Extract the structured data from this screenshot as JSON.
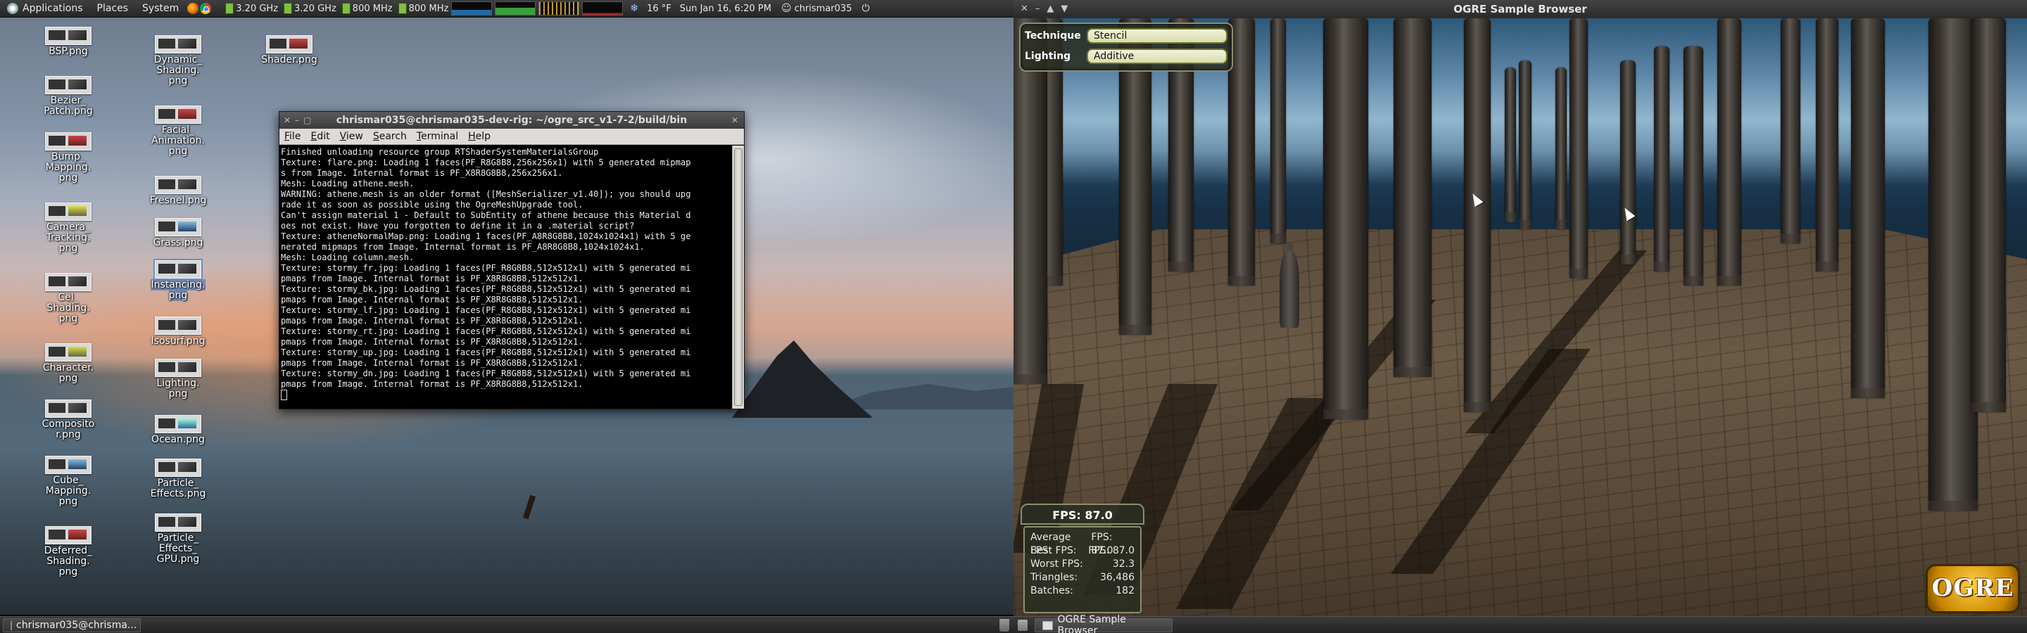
{
  "top_panel": {
    "menus": [
      "Applications",
      "Places",
      "System"
    ],
    "cpu_freqs": [
      "3.20 GHz",
      "3.20 GHz",
      "800 MHz",
      "800 MHz"
    ],
    "weather": "16 °F",
    "datetime": "Sun Jan 16,  6:20 PM",
    "user": "chrismar035"
  },
  "desktop_icons": [
    {
      "label": "BSP.png"
    },
    {
      "label": "Bezier_\nPatch.png"
    },
    {
      "label": "Bump_\nMapping.\npng"
    },
    {
      "label": "Camera_\nTracking.\npng"
    },
    {
      "label": "Cel_\nShading.\npng"
    },
    {
      "label": "Character.\npng"
    },
    {
      "label": "Composito\nr.png"
    },
    {
      "label": "Cube_\nMapping.\npng"
    },
    {
      "label": "Deferred_\nShading.\npng"
    },
    {
      "label": "Dynamic_\nShading.\npng"
    },
    {
      "label": "Facial_\nAnimation.\npng"
    },
    {
      "label": "Fresnel.png"
    },
    {
      "label": "Grass.png"
    },
    {
      "label": "Instancing.\npng"
    },
    {
      "label": "Isosurf.png"
    },
    {
      "label": "Lighting.\npng"
    },
    {
      "label": "Ocean.png"
    },
    {
      "label": "Particle_\nEffects.png"
    },
    {
      "label": "Particle_\nEffects_\nGPU.png"
    },
    {
      "label": "Shader.png"
    }
  ],
  "terminal": {
    "title": "chrismar035@chrismar035-dev-rig: ~/ogre_src_v1-7-2/build/bin",
    "menu": [
      "File",
      "Edit",
      "View",
      "Search",
      "Terminal",
      "Help"
    ],
    "lines": [
      "Finished unloading resource group RTShaderSystemMaterialsGroup",
      "Texture: flare.png: Loading 1 faces(PF_R8G8B8,256x256x1) with 5 generated mipmap",
      "s from Image. Internal format is PF_X8R8G8B8,256x256x1.",
      "Mesh: Loading athene.mesh.",
      "WARNING: athene.mesh is an older format ([MeshSerializer_v1.40]); you should upg",
      "rade it as soon as possible using the OgreMeshUpgrade tool.",
      "Can't assign material 1 - Default to SubEntity of athene because this Material d",
      "oes not exist. Have you forgotten to define it in a .material script?",
      "Texture: atheneNormalMap.png: Loading 1 faces(PF_A8R8G8B8,1024x1024x1) with 5 ge",
      "nerated mipmaps from Image. Internal format is PF_A8R8G8B8,1024x1024x1.",
      "Mesh: Loading column.mesh.",
      "Texture: stormy_fr.jpg: Loading 1 faces(PF_R8G8B8,512x512x1) with 5 generated mi",
      "pmaps from Image. Internal format is PF_X8R8G8B8,512x512x1.",
      "Texture: stormy_bk.jpg: Loading 1 faces(PF_R8G8B8,512x512x1) with 5 generated mi",
      "pmaps from Image. Internal format is PF_X8R8G8B8,512x512x1.",
      "Texture: stormy_lf.jpg: Loading 1 faces(PF_R8G8B8,512x512x1) with 5 generated mi",
      "pmaps from Image. Internal format is PF_X8R8G8B8,512x512x1.",
      "Texture: stormy_rt.jpg: Loading 1 faces(PF_R8G8B8,512x512x1) with 5 generated mi",
      "pmaps from Image. Internal format is PF_X8R8G8B8,512x512x1.",
      "Texture: stormy_up.jpg: Loading 1 faces(PF_R8G8B8,512x512x1) with 5 generated mi",
      "pmaps from Image. Internal format is PF_X8R8G8B8,512x512x1.",
      "Texture: stormy_dn.jpg: Loading 1 faces(PF_R8G8B8,512x512x1) with 5 generated mi",
      "pmaps from Image. Internal format is PF_X8R8G8B8,512x512x1."
    ]
  },
  "taskbar_left": {
    "terminal_task": "chrismar035@chrisma..."
  },
  "ogre": {
    "window_title": "OGRE Sample Browser",
    "technique_label": "Technique",
    "technique_value": "Stencil",
    "lighting_label": "Lighting",
    "lighting_value": "Additive",
    "fps_title": "FPS:  87.0",
    "stats": [
      {
        "label": "Average FPS:",
        "value": "FPS:  87.0"
      },
      {
        "label": "Best FPS:",
        "value": "FPS:  87.0"
      },
      {
        "label": "Worst FPS:",
        "value": "32.3"
      },
      {
        "label": "Triangles:",
        "value": "36,486"
      },
      {
        "label": "Batches:",
        "value": "182"
      }
    ],
    "logo_text": "OGRE"
  },
  "taskbar_right": {
    "ogre_task": "OGRE Sample Browser"
  },
  "colors": {
    "panel": "#2e2e2e",
    "tray_border": "#8a8e70",
    "ogre_gold": "#e2a20f"
  }
}
